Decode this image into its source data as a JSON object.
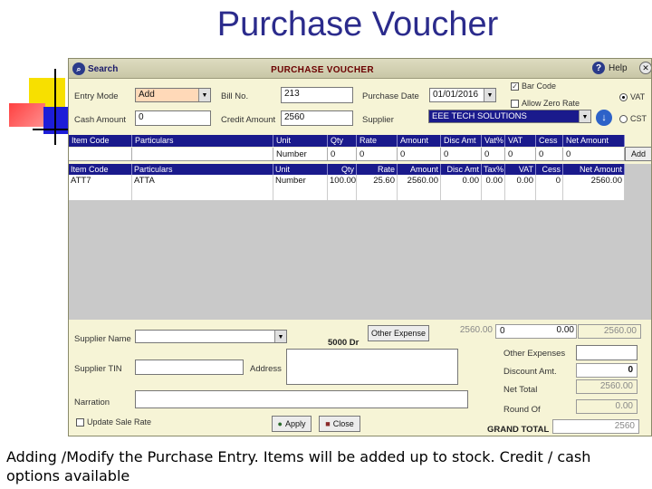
{
  "slide": {
    "title": "Purchase Voucher",
    "caption": "Adding /Modify the Purchase Entry. Items will be added up to stock. Credit / cash options available"
  },
  "window": {
    "search_label": "Search",
    "title": "PURCHASE VOUCHER",
    "help_label": "Help"
  },
  "header_form": {
    "entry_mode_label": "Entry Mode",
    "entry_mode_value": "Add",
    "bill_no_label": "Bill No.",
    "bill_no_value": "213",
    "purchase_date_label": "Purchase Date",
    "purchase_date_value": "01/01/2016",
    "barcode_label": "Bar Code",
    "barcode_checked": true,
    "allow_zero_rate_label": "Allow Zero Rate",
    "vat_label": "VAT",
    "cst_label": "CST",
    "cash_amount_label": "Cash Amount",
    "cash_amount_value": "0",
    "credit_amount_label": "Credit Amount",
    "credit_amount_value": "2560",
    "supplier_label": "Supplier",
    "supplier_value": "EEE TECH SOLUTIONS"
  },
  "entry_line": {
    "headers": [
      "Item Code",
      "Particulars",
      "Unit",
      "Qty",
      "Rate",
      "Amount",
      "Disc Amt",
      "Vat%",
      "VAT",
      "Cess",
      "Net Amount"
    ],
    "values": [
      "",
      "",
      "Number",
      "0",
      "0",
      "0",
      "0",
      "0",
      "0",
      "0",
      "0"
    ],
    "add_label": "Add"
  },
  "items_grid": {
    "headers": [
      "Item Code",
      "Particulars",
      "Unit",
      "Qty",
      "Rate",
      "Amount",
      "Disc Amt",
      "Tax%",
      "VAT",
      "Cess",
      "Net Amount"
    ],
    "rows": [
      [
        "ATT7",
        "ATTA",
        "Number",
        "100.00",
        "25.60",
        "2560.00",
        "0.00",
        "0.00",
        "0.00",
        "0",
        "2560.00"
      ]
    ]
  },
  "summary": {
    "amount_total": "2560.00",
    "disc_total": "0",
    "vat_total": "0.00",
    "net_total_top": "2560.00",
    "other_expense_btn": "Other Expense",
    "supplier_name_label": "Supplier Name",
    "sundry_label": "5000 Dr",
    "supplier_tin_label": "Supplier TIN",
    "address_label": "Address",
    "narration_label": "Narration",
    "update_sale_rate_label": "Update Sale Rate",
    "apply_label": "Apply",
    "close_label": "Close",
    "other_expenses_label": "Other Expenses",
    "discount_amt_label": "Discount Amt.",
    "discount_amt_value": "0",
    "net_total_label": "Net Total",
    "net_total_value": "2560.00",
    "round_off_label": "Round Of",
    "round_off_value": "0.00",
    "grand_total_label": "GRAND TOTAL",
    "grand_total_value": "2560"
  }
}
